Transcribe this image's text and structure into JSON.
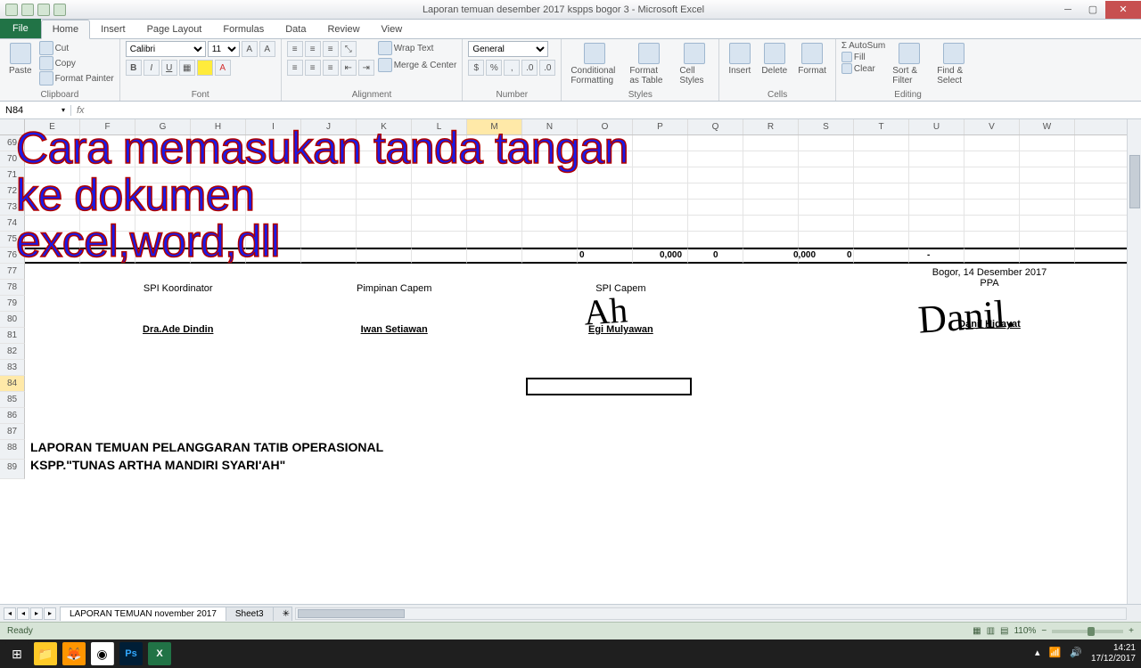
{
  "titlebar": {
    "title": "Laporan temuan desember 2017 kspps bogor 3 - Microsoft Excel"
  },
  "tabs": {
    "file": "File",
    "items": [
      "Home",
      "Insert",
      "Page Layout",
      "Formulas",
      "Data",
      "Review",
      "View"
    ],
    "active": "Home"
  },
  "ribbon": {
    "clipboard": {
      "label": "Clipboard",
      "paste": "Paste",
      "cut": "Cut",
      "copy": "Copy",
      "painter": "Format Painter"
    },
    "font": {
      "label": "Font",
      "name": "Calibri",
      "size": "11"
    },
    "alignment": {
      "label": "Alignment",
      "wrap": "Wrap Text",
      "merge": "Merge & Center"
    },
    "number": {
      "label": "Number",
      "format": "General"
    },
    "styles": {
      "label": "Styles",
      "cond": "Conditional Formatting",
      "table": "Format as Table",
      "cell": "Cell Styles"
    },
    "cells": {
      "label": "Cells",
      "insert": "Insert",
      "delete": "Delete",
      "format": "Format"
    },
    "editing": {
      "label": "Editing",
      "autosum": "AutoSum",
      "fill": "Fill",
      "clear": "Clear",
      "sort": "Sort & Filter",
      "find": "Find & Select"
    }
  },
  "namebox": "N84",
  "rows": [
    "69",
    "70",
    "71",
    "72",
    "73",
    "74",
    "75",
    "76",
    "77",
    "78",
    "79",
    "80",
    "81",
    "82",
    "83",
    "84",
    "85",
    "86",
    "87",
    "88",
    "89"
  ],
  "cols": [
    "E",
    "F",
    "G",
    "H",
    "I",
    "J",
    "K",
    "L",
    "M",
    "N",
    "O",
    "P",
    "Q",
    "R",
    "S",
    "T",
    "U",
    "V",
    "W"
  ],
  "totals": {
    "v1": "0",
    "v2": "0,000",
    "v3": "0",
    "v4": "0,000",
    "v5": "0",
    "v6": "-"
  },
  "sign": {
    "date": "Bogor,   14 Desember 2017",
    "ppa": "PPA",
    "roles": [
      "SPI Koordinator",
      "Pimpinan Capem",
      "SPI Capem"
    ],
    "names": [
      "Dra.Ade Dindin",
      "Iwan Setiawan",
      "Egi Mulyawan",
      "Danil Hidayat"
    ]
  },
  "report": {
    "line1": "LAPORAN TEMUAN PELANGGARAN TATIB OPERASIONAL",
    "line2": "KSPP.\"TUNAS ARTHA MANDIRI SYARI'AH\""
  },
  "overlay": {
    "l1": "Cara memasukan tanda tangan",
    "l2": "ke dokumen",
    "l3": "excel,word,dll"
  },
  "sheets": {
    "active": "LAPORAN TEMUAN november 2017",
    "other": "Sheet3"
  },
  "status": {
    "ready": "Ready",
    "zoom": "110%"
  },
  "taskbar": {
    "time": "14:21",
    "date": "17/12/2017"
  }
}
